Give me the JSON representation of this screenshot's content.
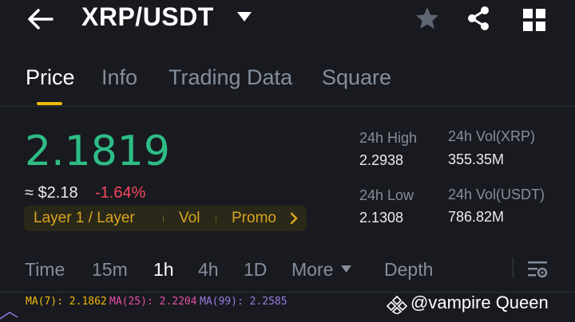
{
  "header": {
    "pair": "XRP/USDT"
  },
  "tabs": [
    {
      "label": "Price"
    },
    {
      "label": "Info"
    },
    {
      "label": "Trading Data"
    },
    {
      "label": "Square"
    }
  ],
  "price": {
    "last": "2.1819",
    "usd": "≈ $2.18",
    "change": "-1.64%"
  },
  "tags": [
    "Layer 1 / Layer",
    "Vol",
    "Promo"
  ],
  "stats": {
    "high_label": "24h High",
    "high_value": "2.2938",
    "low_label": "24h Low",
    "low_value": "2.1308",
    "vol_base_label": "24h Vol(XRP)",
    "vol_base_value": "355.35M",
    "vol_quote_label": "24h Vol(USDT)",
    "vol_quote_value": "786.82M"
  },
  "intervals": [
    {
      "label": "Time"
    },
    {
      "label": "15m"
    },
    {
      "label": "1h"
    },
    {
      "label": "4h"
    },
    {
      "label": "1D"
    },
    {
      "label": "More"
    },
    {
      "label": "Depth"
    }
  ],
  "ma": [
    {
      "label": "MA(7): 2.1862",
      "color": "#f0b90b"
    },
    {
      "label": "MA(25): 2.2204",
      "color": "#e84fa6"
    },
    {
      "label": "MA(99): 2.2585",
      "color": "#9b7be0"
    }
  ],
  "watermark": "@vampire Queen",
  "colors": {
    "up": "#2ebd85",
    "down": "#f6465d",
    "accent": "#f0b90b"
  }
}
